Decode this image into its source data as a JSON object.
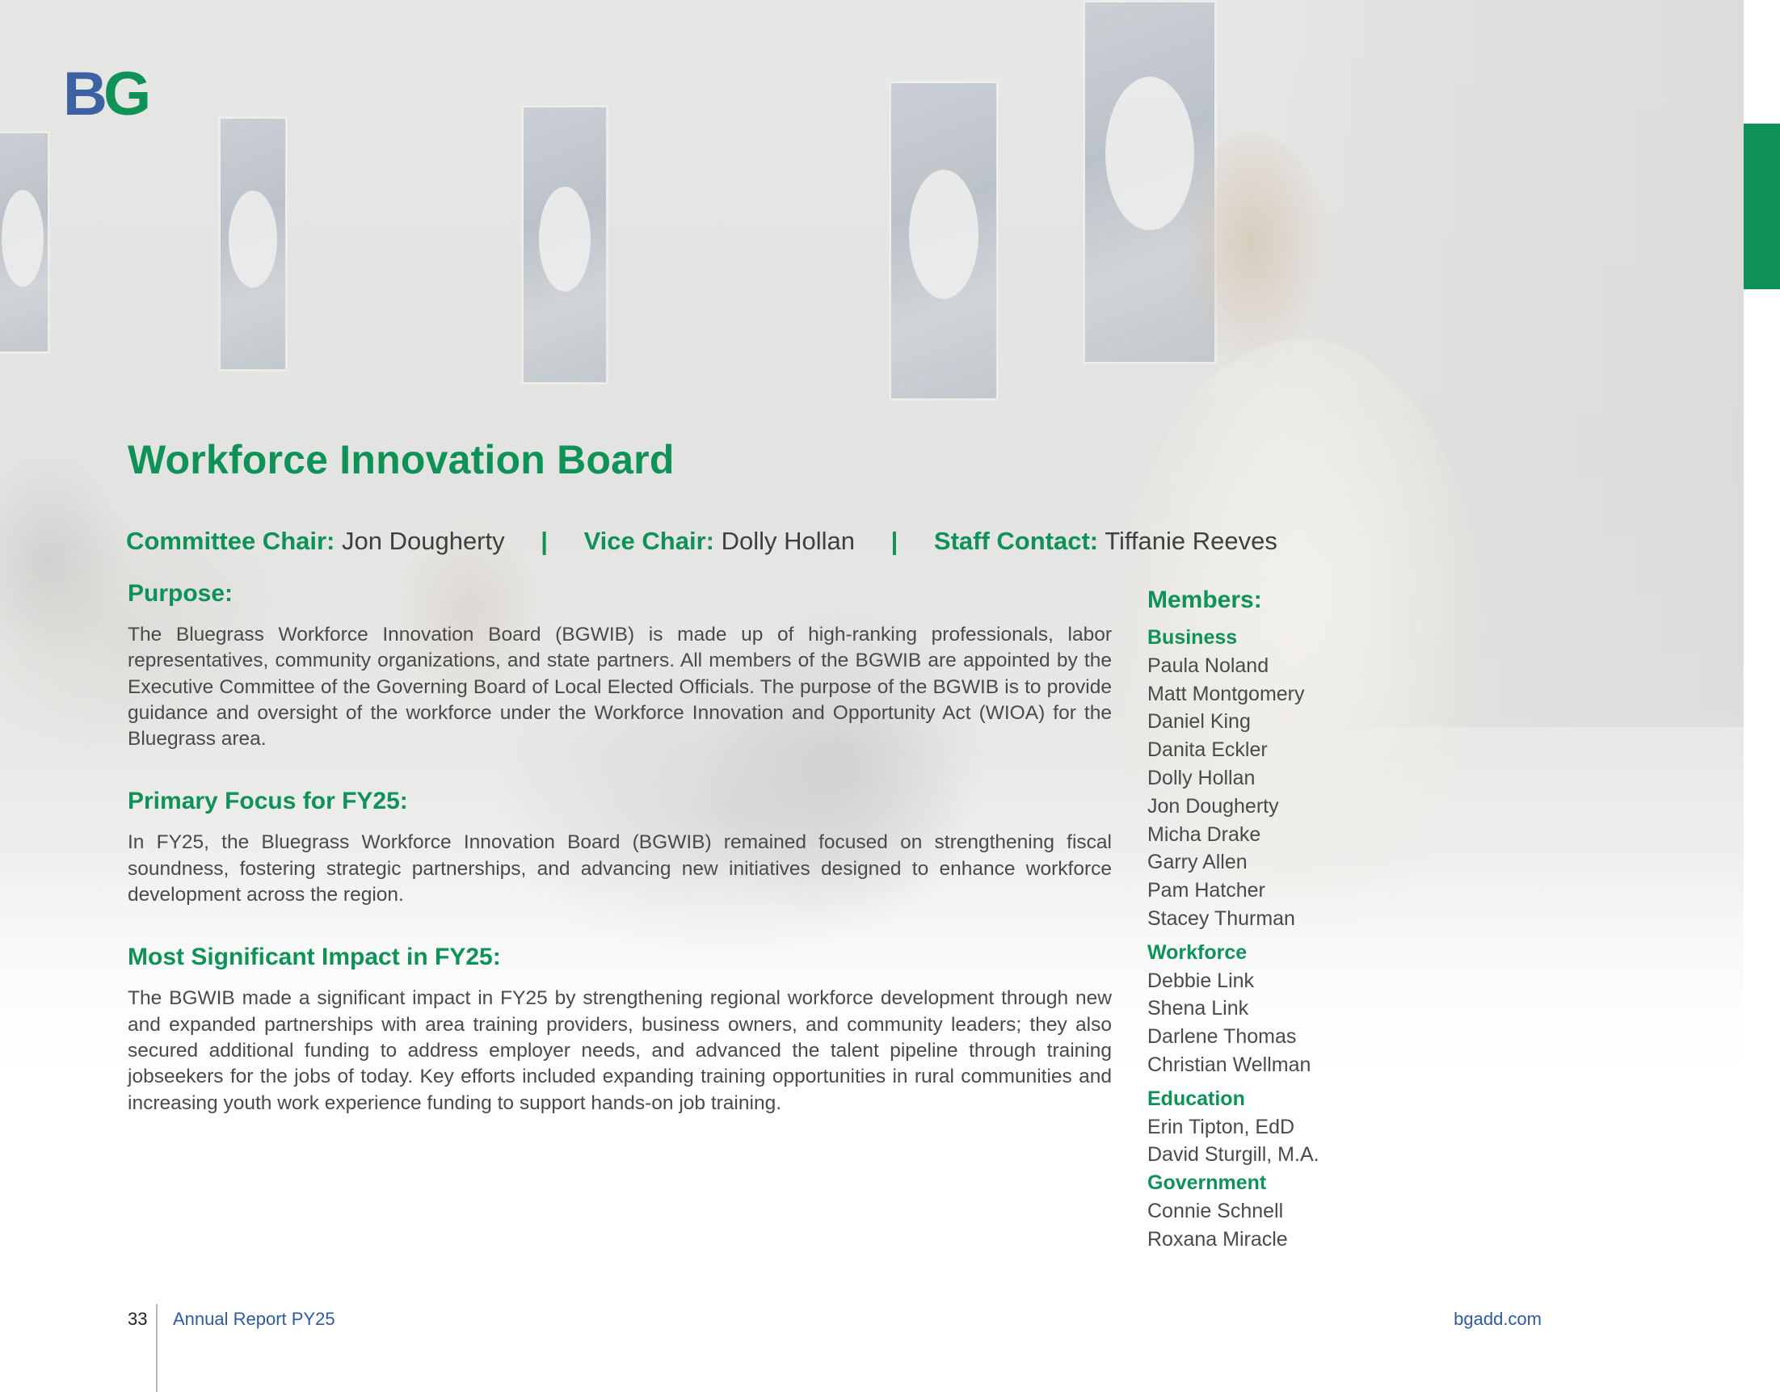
{
  "logo": {
    "text": "BG"
  },
  "title": "Workforce Innovation Board",
  "roles": [
    {
      "label": "Committee Chair:",
      "name": "Jon Dougherty"
    },
    {
      "label": "Vice Chair:",
      "name": "Dolly Hollan"
    },
    {
      "label": "Staff Contact:",
      "name": "Tiffanie Reeves"
    }
  ],
  "separator": "|",
  "sections": [
    {
      "heading": "Purpose:",
      "body": "The Bluegrass Workforce Innovation Board (BGWIB) is made up of high-ranking professionals, labor representatives, community organizations, and state partners. All members of the BGWIB are appointed by the Executive Committee of the Governing Board of Local Elected Officials. The purpose of the BGWIB is to provide guidance and oversight of the workforce under the Workforce Innovation and Opportunity Act (WIOA) for the Bluegrass area."
    },
    {
      "heading": "Primary Focus for FY25:",
      "body": "In FY25, the Bluegrass Workforce Innovation Board (BGWIB) remained focused on strengthening fiscal soundness, fostering strategic partnerships, and advancing new initiatives designed to enhance workforce development across the region."
    },
    {
      "heading": "Most Significant Impact in FY25:",
      "body": "The BGWIB made a significant impact in FY25 by strengthening regional workforce development through new and expanded partnerships with area training providers, business owners, and community leaders; they also secured additional funding to address employer needs, and advanced the talent pipeline through training jobseekers for the jobs of today. Key efforts included expanding training opportunities in rural communities and increasing youth work experience funding to support hands-on job training."
    }
  ],
  "members": {
    "heading": "Members:",
    "groups": [
      {
        "title": "Business",
        "names": [
          "Paula Noland",
          "Matt Montgomery",
          "Daniel King",
          "Danita Eckler",
          "Dolly Hollan",
          "Jon Dougherty",
          "Micha Drake",
          "Garry Allen",
          "Pam Hatcher",
          "Stacey Thurman"
        ]
      },
      {
        "title": "Workforce",
        "names": [
          "Debbie Link",
          "Shena Link",
          "Darlene Thomas",
          "Christian Wellman"
        ]
      },
      {
        "title": "Education",
        "names": [
          "Erin Tipton, EdD",
          "David Sturgill, M.A."
        ]
      },
      {
        "title": "Government",
        "names": [
          "Connie Schnell",
          "Roxana Miracle"
        ]
      }
    ]
  },
  "footer": {
    "page_number": "33",
    "report_name": "Annual Report PY25",
    "website": "bgadd.com"
  },
  "colors": {
    "accent_green": "#0f9258",
    "accent_blue": "#2f5a9e",
    "logo_blue": "#3d62a4"
  }
}
